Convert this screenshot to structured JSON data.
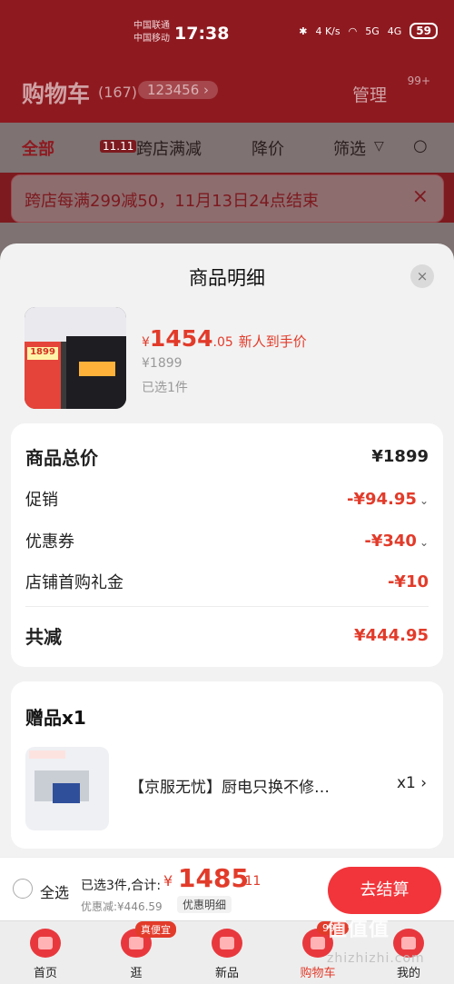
{
  "status": {
    "carrier1": "中国联通",
    "carrier2": "中国移动",
    "time": "17:38",
    "speed": "4 K/s",
    "net1": "5G",
    "net2": "4G",
    "battery": "59"
  },
  "background": {
    "title": "购物车",
    "count": "(167)",
    "pill": "123456 ›",
    "manage": "管理",
    "more_badge": "99+",
    "tabs": [
      "全部",
      "跨店满减",
      "降价",
      "筛选"
    ],
    "tab_badge": "11.11",
    "notice": "跨店每满299减50，11月13日24点结束",
    "notice_close": "×"
  },
  "sheet": {
    "title": "商品明细",
    "close": "×",
    "product": {
      "price_currency": "¥",
      "price_int": "1454",
      "price_dec": ".05",
      "price_note": "新人到手价",
      "original_price": "¥1899",
      "selected": "已选1件",
      "image_text": "1899"
    },
    "breakdown": {
      "total_label": "商品总价",
      "total_value": "¥1899",
      "promo_label": "促销",
      "promo_value": "-¥94.95",
      "coupon_label": "优惠券",
      "coupon_value": "-¥340",
      "gift_cash_label": "店铺首购礼金",
      "gift_cash_value": "-¥10",
      "reduce_label": "共减",
      "reduce_value": "¥444.95",
      "chevron": "⌄"
    },
    "gift": {
      "title": "赠品x1",
      "name": "【京服无忧】厨电只换不修…",
      "qty": "x1 ›"
    }
  },
  "bottom_bar": {
    "select_all": "全选",
    "summary": "已选3件,合计:",
    "total_currency": "¥",
    "total_int": "1485",
    "total_dec": ".11",
    "discount": "优惠减:¥446.59",
    "detail_chip": "优惠明细",
    "checkout": "去结算"
  },
  "tab_bar": {
    "items": [
      {
        "label": "首页"
      },
      {
        "label": "逛",
        "badge": "真便宜"
      },
      {
        "label": "新品"
      },
      {
        "label": "购物车",
        "badge": "99+"
      },
      {
        "label": "我的"
      }
    ]
  },
  "watermark": {
    "text": "值值值",
    "url": "zhizhizhi.com"
  }
}
